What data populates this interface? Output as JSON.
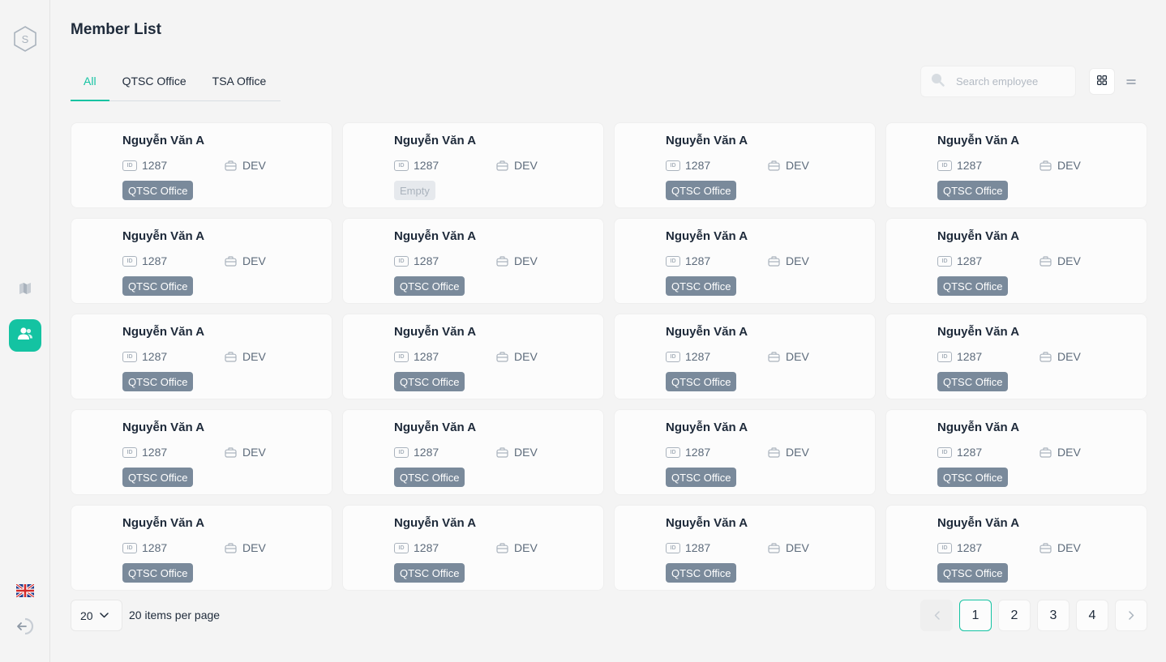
{
  "page_title": "Member List",
  "tabs": [
    {
      "label": "All",
      "active": true
    },
    {
      "label": "QTSC Office",
      "active": false
    },
    {
      "label": "TSA Office",
      "active": false
    }
  ],
  "search": {
    "placeholder": "Search employee",
    "value": ""
  },
  "view_modes": [
    {
      "icon": "grid-view-icon",
      "active": true
    },
    {
      "icon": "list-view-icon",
      "active": false
    }
  ],
  "sidebar": {
    "logo": "S",
    "items": [
      {
        "icon": "map-icon",
        "active": false
      },
      {
        "icon": "users-icon",
        "active": true
      }
    ],
    "footer": [
      {
        "icon": "uk-flag-icon"
      },
      {
        "icon": "logout-icon"
      }
    ]
  },
  "members": [
    {
      "name": "Nguyễn Văn A",
      "id": "1287",
      "dept": "DEV",
      "office": "QTSC Office"
    },
    {
      "name": "Nguyễn Văn A",
      "id": "1287",
      "dept": "DEV",
      "office": "Empty"
    },
    {
      "name": "Nguyễn Văn A",
      "id": "1287",
      "dept": "DEV",
      "office": "QTSC Office"
    },
    {
      "name": "Nguyễn Văn A",
      "id": "1287",
      "dept": "DEV",
      "office": "QTSC Office"
    },
    {
      "name": "Nguyễn Văn A",
      "id": "1287",
      "dept": "DEV",
      "office": "QTSC Office"
    },
    {
      "name": "Nguyễn Văn A",
      "id": "1287",
      "dept": "DEV",
      "office": "QTSC Office"
    },
    {
      "name": "Nguyễn Văn A",
      "id": "1287",
      "dept": "DEV",
      "office": "QTSC Office"
    },
    {
      "name": "Nguyễn Văn A",
      "id": "1287",
      "dept": "DEV",
      "office": "QTSC Office"
    },
    {
      "name": "Nguyễn Văn A",
      "id": "1287",
      "dept": "DEV",
      "office": "QTSC Office"
    },
    {
      "name": "Nguyễn Văn A",
      "id": "1287",
      "dept": "DEV",
      "office": "QTSC Office"
    },
    {
      "name": "Nguyễn Văn A",
      "id": "1287",
      "dept": "DEV",
      "office": "QTSC Office"
    },
    {
      "name": "Nguyễn Văn A",
      "id": "1287",
      "dept": "DEV",
      "office": "QTSC Office"
    },
    {
      "name": "Nguyễn Văn A",
      "id": "1287",
      "dept": "DEV",
      "office": "QTSC Office"
    },
    {
      "name": "Nguyễn Văn A",
      "id": "1287",
      "dept": "DEV",
      "office": "QTSC Office"
    },
    {
      "name": "Nguyễn Văn A",
      "id": "1287",
      "dept": "DEV",
      "office": "QTSC Office"
    },
    {
      "name": "Nguyễn Văn A",
      "id": "1287",
      "dept": "DEV",
      "office": "QTSC Office"
    },
    {
      "name": "Nguyễn Văn A",
      "id": "1287",
      "dept": "DEV",
      "office": "QTSC Office"
    },
    {
      "name": "Nguyễn Văn A",
      "id": "1287",
      "dept": "DEV",
      "office": "QTSC Office"
    },
    {
      "name": "Nguyễn Văn A",
      "id": "1287",
      "dept": "DEV",
      "office": "QTSC Office"
    },
    {
      "name": "Nguyễn Văn A",
      "id": "1287",
      "dept": "DEV",
      "office": "QTSC Office"
    }
  ],
  "id_icon_text": "ID",
  "pagination": {
    "page_size": "20",
    "page_size_label": "20 items per page",
    "pages": [
      "1",
      "2",
      "3",
      "4"
    ],
    "current_page": "1"
  },
  "colors": {
    "accent": "#14c3a2",
    "office_badge": "#7a8a9b",
    "empty_badge": "#e6e9ed"
  }
}
